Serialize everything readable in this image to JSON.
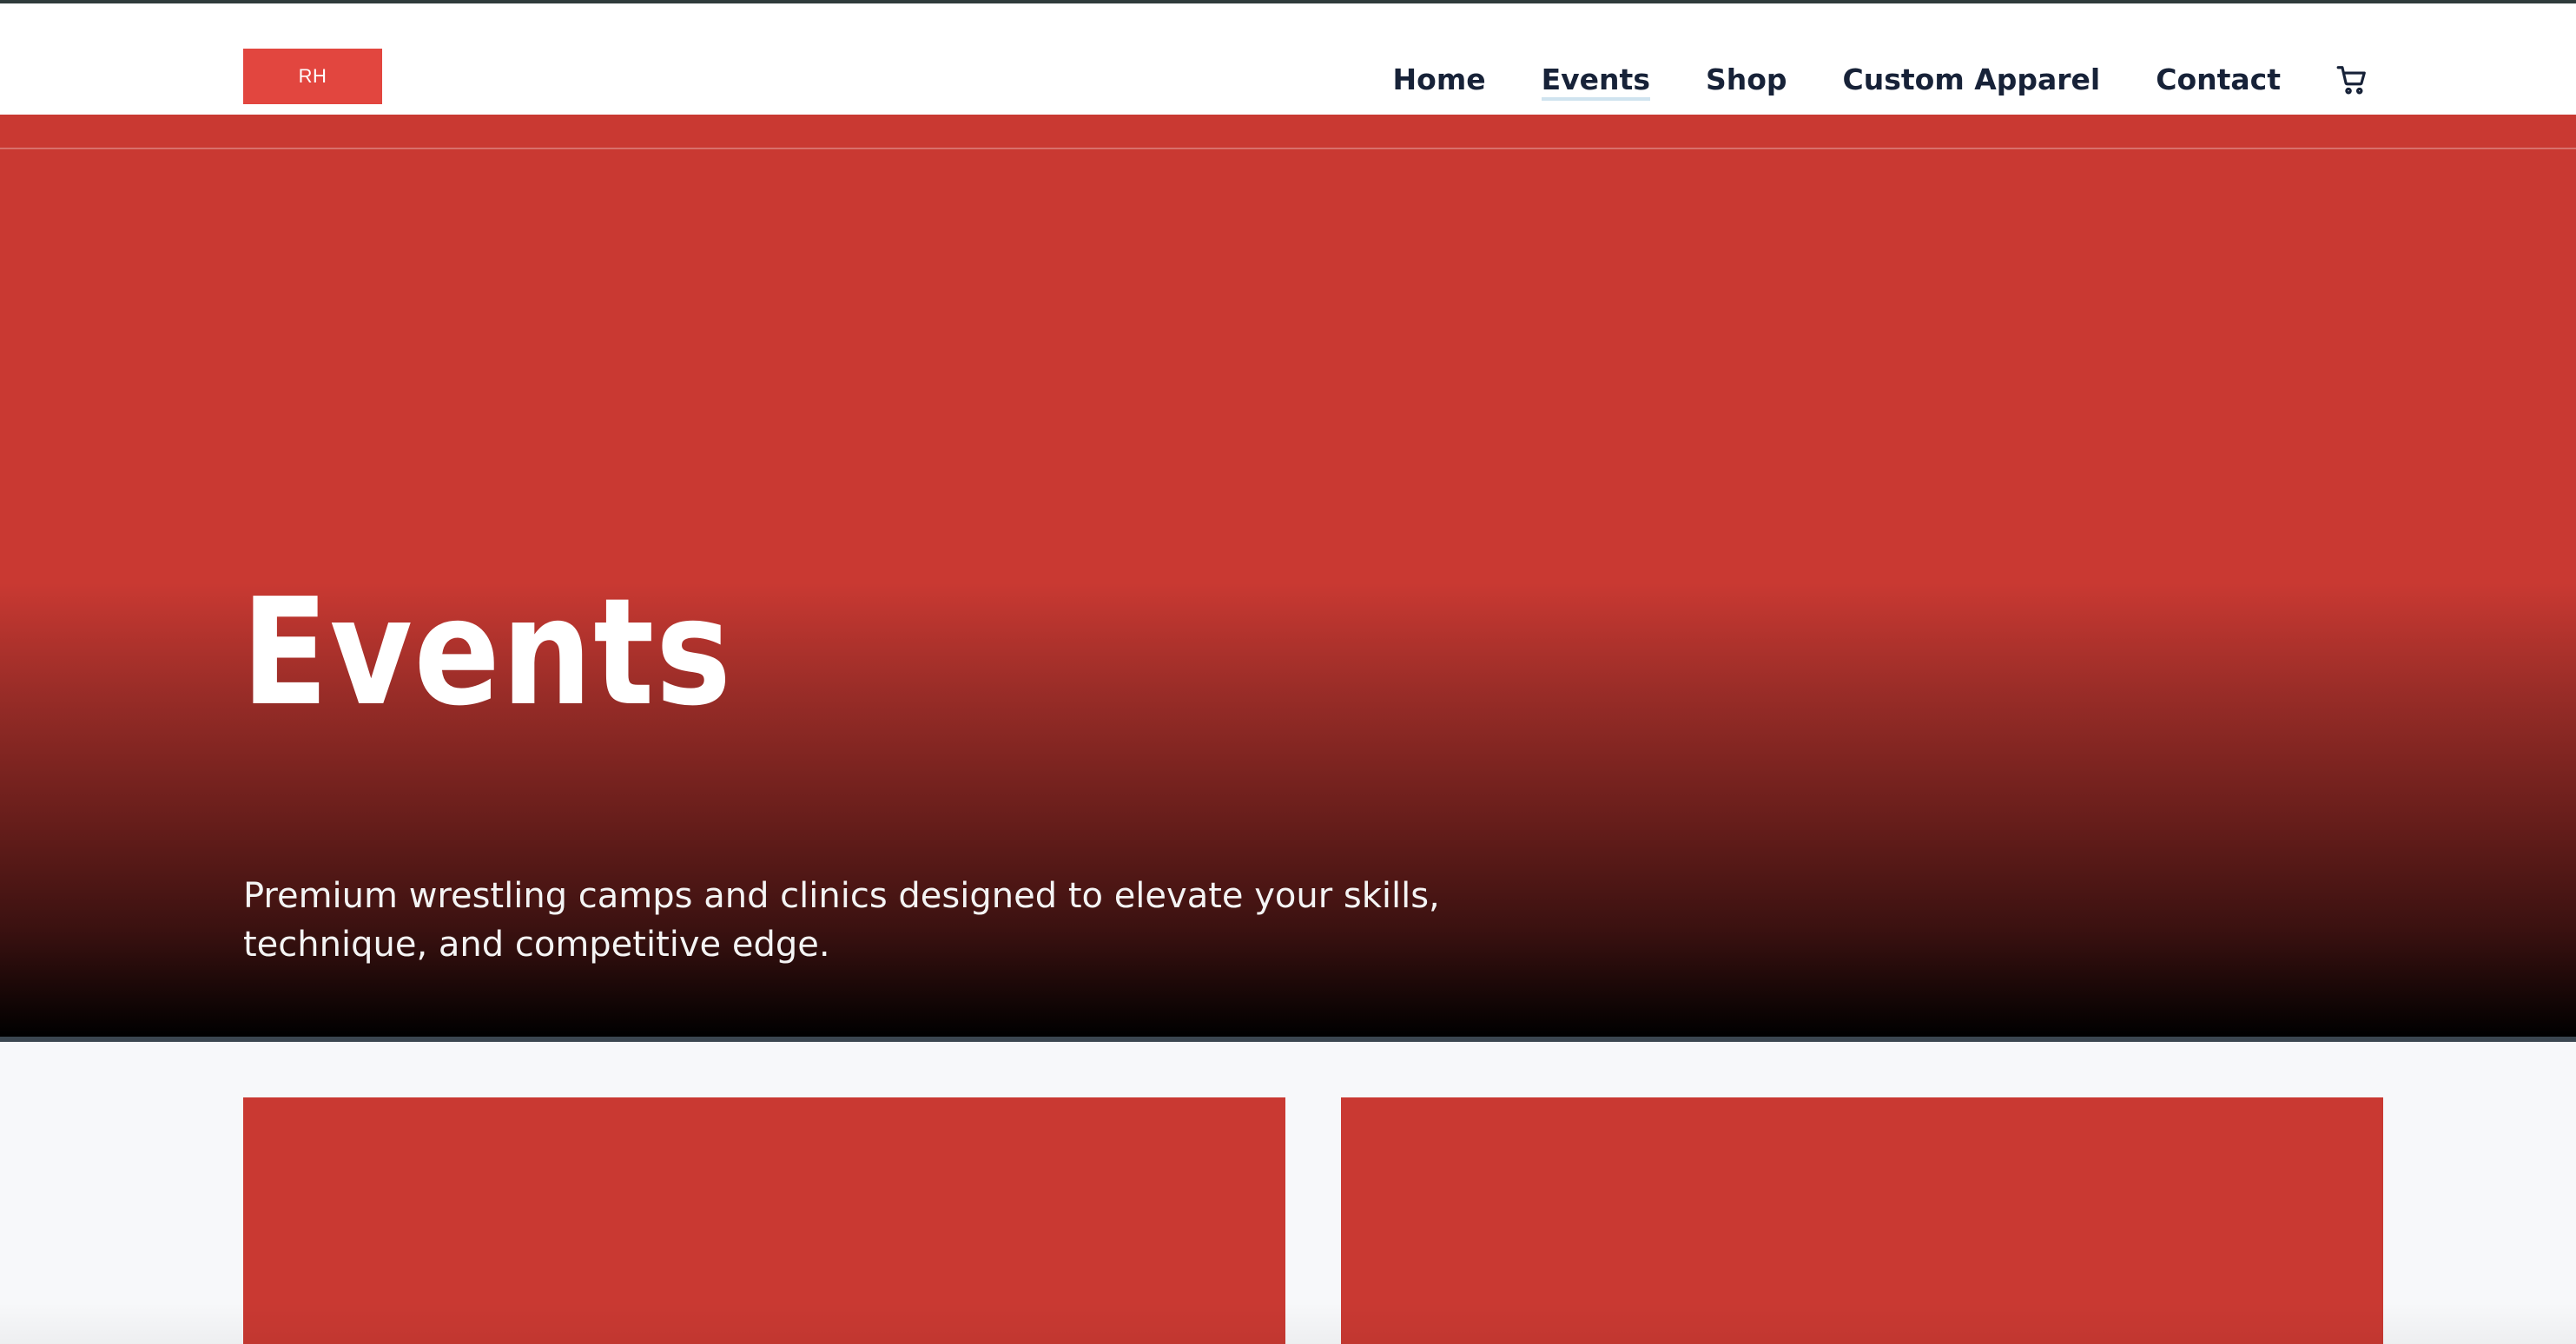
{
  "header": {
    "logo_text": "RH",
    "nav": [
      {
        "label": "Home",
        "active": false
      },
      {
        "label": "Events",
        "active": true
      },
      {
        "label": "Shop",
        "active": false
      },
      {
        "label": "Custom Apparel",
        "active": false
      },
      {
        "label": "Contact",
        "active": false
      }
    ],
    "cart_icon": "cart-icon"
  },
  "hero": {
    "title": "Events",
    "subtitle": "Premium wrestling camps and clinics designed to elevate your skills, technique, and competitive edge."
  },
  "colors": {
    "brand_red": "#c93932",
    "logo_red": "#e2463f",
    "nav_text": "#172238"
  }
}
